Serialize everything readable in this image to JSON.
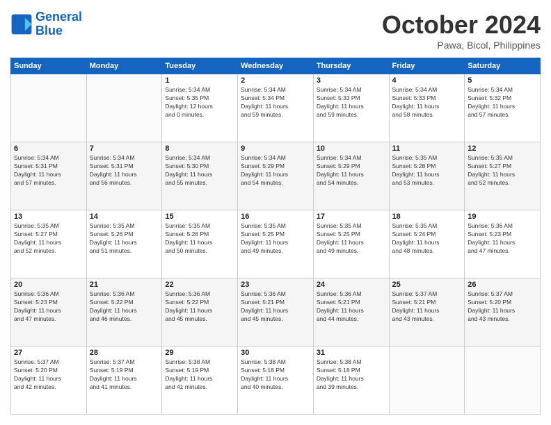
{
  "logo": {
    "line1": "General",
    "line2": "Blue"
  },
  "title": "October 2024",
  "subtitle": "Pawa, Bicol, Philippines",
  "weekdays": [
    "Sunday",
    "Monday",
    "Tuesday",
    "Wednesday",
    "Thursday",
    "Friday",
    "Saturday"
  ],
  "weeks": [
    [
      {
        "day": "",
        "info": ""
      },
      {
        "day": "",
        "info": ""
      },
      {
        "day": "1",
        "info": "Sunrise: 5:34 AM\nSunset: 5:35 PM\nDaylight: 12 hours\nand 0 minutes."
      },
      {
        "day": "2",
        "info": "Sunrise: 5:34 AM\nSunset: 5:34 PM\nDaylight: 11 hours\nand 59 minutes."
      },
      {
        "day": "3",
        "info": "Sunrise: 5:34 AM\nSunset: 5:33 PM\nDaylight: 11 hours\nand 59 minutes."
      },
      {
        "day": "4",
        "info": "Sunrise: 5:34 AM\nSunset: 5:33 PM\nDaylight: 11 hours\nand 58 minutes."
      },
      {
        "day": "5",
        "info": "Sunrise: 5:34 AM\nSunset: 5:32 PM\nDaylight: 11 hours\nand 57 minutes."
      }
    ],
    [
      {
        "day": "6",
        "info": "Sunrise: 5:34 AM\nSunset: 5:31 PM\nDaylight: 11 hours\nand 57 minutes."
      },
      {
        "day": "7",
        "info": "Sunrise: 5:34 AM\nSunset: 5:31 PM\nDaylight: 11 hours\nand 56 minutes."
      },
      {
        "day": "8",
        "info": "Sunrise: 5:34 AM\nSunset: 5:30 PM\nDaylight: 11 hours\nand 55 minutes."
      },
      {
        "day": "9",
        "info": "Sunrise: 5:34 AM\nSunset: 5:29 PM\nDaylight: 11 hours\nand 54 minutes."
      },
      {
        "day": "10",
        "info": "Sunrise: 5:34 AM\nSunset: 5:29 PM\nDaylight: 11 hours\nand 54 minutes."
      },
      {
        "day": "11",
        "info": "Sunrise: 5:35 AM\nSunset: 5:28 PM\nDaylight: 11 hours\nand 53 minutes."
      },
      {
        "day": "12",
        "info": "Sunrise: 5:35 AM\nSunset: 5:27 PM\nDaylight: 11 hours\nand 52 minutes."
      }
    ],
    [
      {
        "day": "13",
        "info": "Sunrise: 5:35 AM\nSunset: 5:27 PM\nDaylight: 11 hours\nand 52 minutes."
      },
      {
        "day": "14",
        "info": "Sunrise: 5:35 AM\nSunset: 5:26 PM\nDaylight: 11 hours\nand 51 minutes."
      },
      {
        "day": "15",
        "info": "Sunrise: 5:35 AM\nSunset: 5:26 PM\nDaylight: 11 hours\nand 50 minutes."
      },
      {
        "day": "16",
        "info": "Sunrise: 5:35 AM\nSunset: 5:25 PM\nDaylight: 11 hours\nand 49 minutes."
      },
      {
        "day": "17",
        "info": "Sunrise: 5:35 AM\nSunset: 5:25 PM\nDaylight: 11 hours\nand 49 minutes."
      },
      {
        "day": "18",
        "info": "Sunrise: 5:35 AM\nSunset: 5:24 PM\nDaylight: 11 hours\nand 48 minutes."
      },
      {
        "day": "19",
        "info": "Sunrise: 5:36 AM\nSunset: 5:23 PM\nDaylight: 11 hours\nand 47 minutes."
      }
    ],
    [
      {
        "day": "20",
        "info": "Sunrise: 5:36 AM\nSunset: 5:23 PM\nDaylight: 11 hours\nand 47 minutes."
      },
      {
        "day": "21",
        "info": "Sunrise: 5:36 AM\nSunset: 5:22 PM\nDaylight: 11 hours\nand 46 minutes."
      },
      {
        "day": "22",
        "info": "Sunrise: 5:36 AM\nSunset: 5:22 PM\nDaylight: 11 hours\nand 45 minutes."
      },
      {
        "day": "23",
        "info": "Sunrise: 5:36 AM\nSunset: 5:21 PM\nDaylight: 11 hours\nand 45 minutes."
      },
      {
        "day": "24",
        "info": "Sunrise: 5:36 AM\nSunset: 5:21 PM\nDaylight: 11 hours\nand 44 minutes."
      },
      {
        "day": "25",
        "info": "Sunrise: 5:37 AM\nSunset: 5:21 PM\nDaylight: 11 hours\nand 43 minutes."
      },
      {
        "day": "26",
        "info": "Sunrise: 5:37 AM\nSunset: 5:20 PM\nDaylight: 11 hours\nand 43 minutes."
      }
    ],
    [
      {
        "day": "27",
        "info": "Sunrise: 5:37 AM\nSunset: 5:20 PM\nDaylight: 11 hours\nand 42 minutes."
      },
      {
        "day": "28",
        "info": "Sunrise: 5:37 AM\nSunset: 5:19 PM\nDaylight: 11 hours\nand 41 minutes."
      },
      {
        "day": "29",
        "info": "Sunrise: 5:38 AM\nSunset: 5:19 PM\nDaylight: 11 hours\nand 41 minutes."
      },
      {
        "day": "30",
        "info": "Sunrise: 5:38 AM\nSunset: 5:18 PM\nDaylight: 11 hours\nand 40 minutes."
      },
      {
        "day": "31",
        "info": "Sunrise: 5:38 AM\nSunset: 5:18 PM\nDaylight: 11 hours\nand 39 minutes."
      },
      {
        "day": "",
        "info": ""
      },
      {
        "day": "",
        "info": ""
      }
    ]
  ]
}
